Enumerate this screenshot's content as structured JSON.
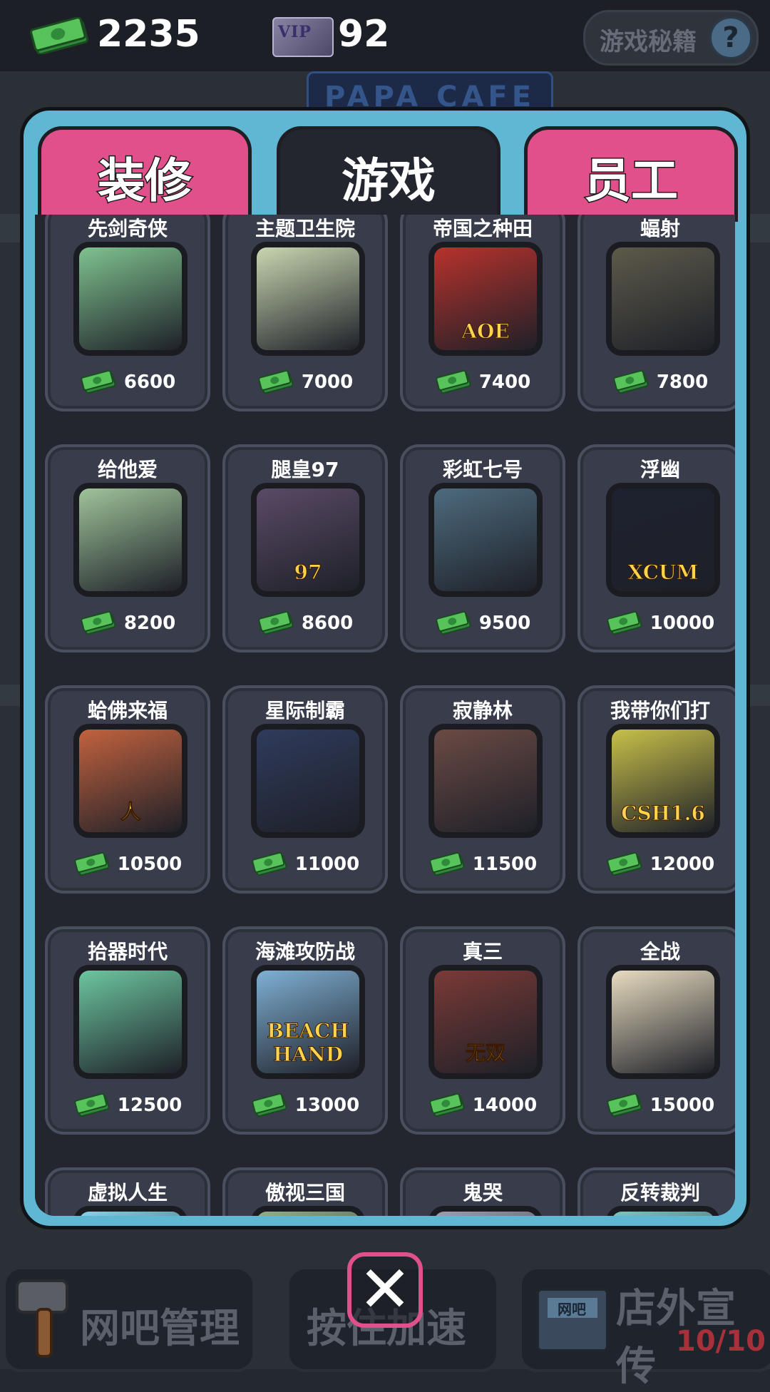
{
  "top_bar": {
    "cash": "2235",
    "vip_badge": "VIP",
    "vip_value": "92",
    "guide_label": "游戏秘籍",
    "guide_icon": "question-icon"
  },
  "tabs": [
    {
      "label": "装修",
      "active": false
    },
    {
      "label": "游戏",
      "active": true
    },
    {
      "label": "员工",
      "active": false
    }
  ],
  "games": [
    {
      "name": "先剑奇侠",
      "price": "6600",
      "icon": "girl-portrait-icon",
      "color": "#7fc28f"
    },
    {
      "name": "主题卫生院",
      "price": "7000",
      "icon": "green-asterisk-icon",
      "color": "#c9d6b0"
    },
    {
      "name": "帝国之种田",
      "price": "7400",
      "icon": "king-aoe-icon",
      "color": "#b7322c",
      "art_text": "AOE"
    },
    {
      "name": "蝠射",
      "price": "7800",
      "icon": "gas-mask-helmet-icon",
      "color": "#5d5a4a"
    },
    {
      "name": "给他爱",
      "price": "8200",
      "icon": "screaming-cat-icon",
      "color": "#9fc49a"
    },
    {
      "name": "腿皇97",
      "price": "8600",
      "icon": "fist-97-icon",
      "color": "#5a4a66",
      "art_text": "97"
    },
    {
      "name": "彩虹七号",
      "price": "9500",
      "icon": "soldier-helmet-icon",
      "color": "#4d6b7e"
    },
    {
      "name": "浮幽",
      "price": "10000",
      "icon": "alien-xcum-icon",
      "color": "#1e2230",
      "art_text": "XCUM"
    },
    {
      "name": "蛤佛来福",
      "price": "10500",
      "icon": "ren-symbol-icon",
      "color": "#c2623e",
      "art_text": "人"
    },
    {
      "name": "星际制霸",
      "price": "11000",
      "icon": "space-marine-icon",
      "color": "#2f3b5c"
    },
    {
      "name": "寂静林",
      "price": "11500",
      "icon": "faceless-nurse-icon",
      "color": "#6b4a44"
    },
    {
      "name": "我带你们打",
      "price": "12000",
      "icon": "cs-terrorist-icon",
      "color": "#c8c04a",
      "art_text": "CSH1.6"
    },
    {
      "name": "拾器时代",
      "price": "12500",
      "icon": "caveman-girl-icon",
      "color": "#6cc6a0"
    },
    {
      "name": "海滩攻防战",
      "price": "13000",
      "icon": "beach-tank-icon",
      "color": "#7fb0d4",
      "art_text": "BEACH HAND"
    },
    {
      "name": "真三",
      "price": "14000",
      "icon": "horse-rider-icon",
      "color": "#7a3a36",
      "art_text": "无双"
    },
    {
      "name": "全战",
      "price": "15000",
      "icon": "winged-helmet-icon",
      "color": "#e8dcc0"
    },
    {
      "name": "虚拟人生",
      "price": "",
      "icon": "partial-icon",
      "color": "#86d4e6"
    },
    {
      "name": "傲视三国",
      "price": "",
      "icon": "partial-icon",
      "color": "#8fb08a"
    },
    {
      "name": "鬼哭",
      "price": "",
      "icon": "partial-icon",
      "color": "#9aa0b0"
    },
    {
      "name": "反转裁判",
      "price": "",
      "icon": "partial-icon",
      "color": "#7cc6c0"
    }
  ],
  "backdrop": {
    "sign_text": "PAPA CAFE"
  },
  "bottom_bar": {
    "manage_label": "网吧管理",
    "speed_label": "按住加速",
    "promo_label": "店外宣传",
    "shop_sign": "网吧",
    "promo_count": "10/10"
  },
  "close_button": {
    "label": "✕"
  }
}
